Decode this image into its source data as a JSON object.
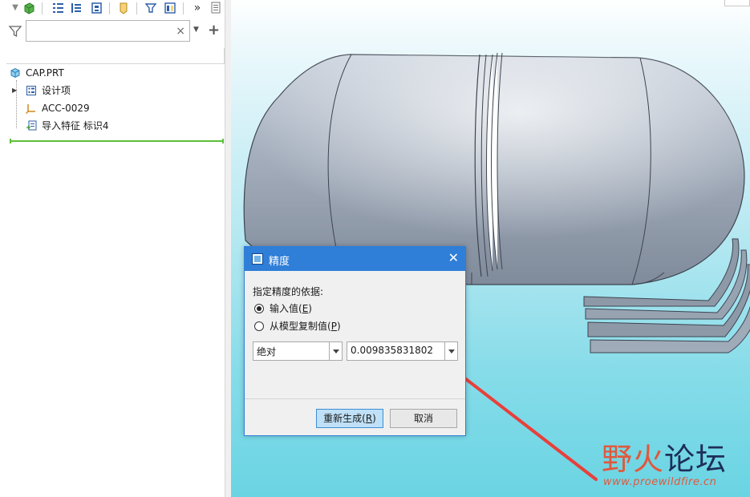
{
  "model_tree": {
    "search": {
      "value": "",
      "placeholder": "",
      "clear_glyph": "×"
    },
    "items": [
      {
        "label": "CAP.PRT",
        "icon": "part-icon"
      },
      {
        "label": "设计项",
        "icon": "design-items-icon"
      },
      {
        "label": "ACC-0029",
        "icon": "coordinate-system-icon"
      },
      {
        "label": "导入特征 标识4",
        "icon": "import-feature-icon"
      }
    ]
  },
  "toolbar": {
    "more_glyph": "»"
  },
  "dialog": {
    "title": "精度",
    "close_glyph": "✕",
    "basis_label": "指定精度的依据:",
    "options": [
      {
        "label": "输入值(",
        "key": "E",
        "suffix": ")",
        "selected": true
      },
      {
        "label": "从模型复制值(",
        "key": "P",
        "suffix": ")",
        "selected": false
      }
    ],
    "mode_value": "绝对",
    "precision_value": "0.009835831802",
    "buttons": {
      "regenerate": {
        "label": "重新生成(",
        "key": "R",
        "suffix": ")"
      },
      "cancel": {
        "label": "取消"
      }
    }
  },
  "watermark": {
    "ye": "野",
    "huo": "火",
    "lun": "论坛",
    "url": "www.proewildfire.cn"
  },
  "colors": {
    "dialog_accent": "#2f7ed8",
    "insert_line": "#5cbf3a",
    "annotation_arrow": "#e8403a",
    "model_body": "#a8b3c2"
  }
}
